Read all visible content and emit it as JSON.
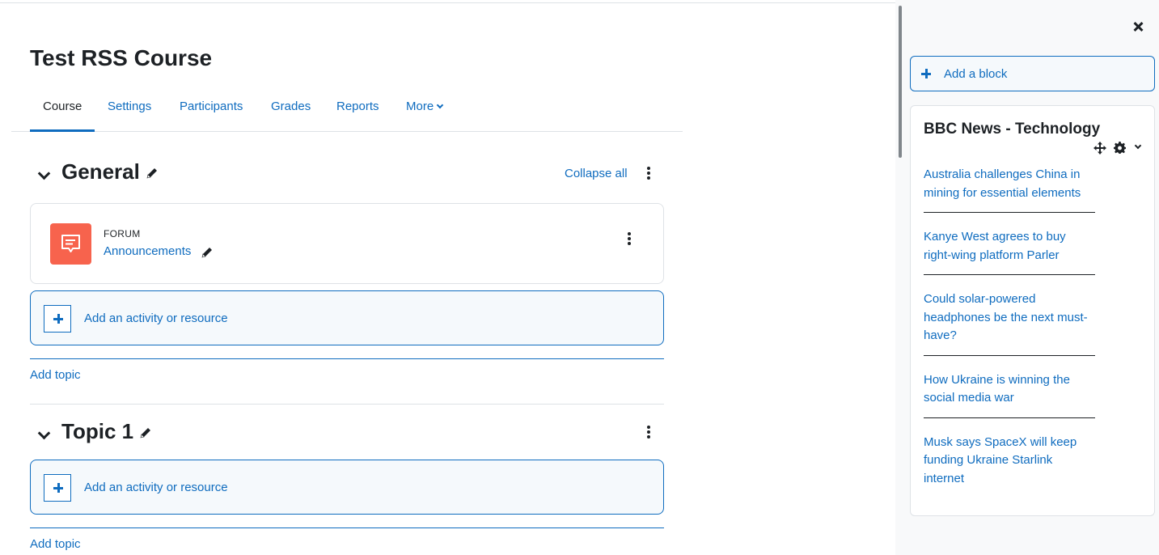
{
  "course": {
    "title": "Test RSS Course"
  },
  "nav": {
    "tabs": [
      {
        "label": "Course",
        "active": true
      },
      {
        "label": "Settings"
      },
      {
        "label": "Participants"
      },
      {
        "label": "Grades"
      },
      {
        "label": "Reports"
      },
      {
        "label": "More"
      }
    ]
  },
  "sections": {
    "general": {
      "title": "General",
      "collapse_all": "Collapse all",
      "activity": {
        "type": "FORUM",
        "name": "Announcements",
        "icon": "forum-icon",
        "icon_color": "#f7634d"
      },
      "add_activity": "Add an activity or resource",
      "add_topic": "Add topic"
    },
    "topic1": {
      "title": "Topic 1",
      "add_activity": "Add an activity or resource",
      "add_topic": "Add topic"
    }
  },
  "drawer": {
    "add_block": "Add a block",
    "block": {
      "title": "BBC News - Technology",
      "items": [
        "Australia challenges China in mining for essential elements",
        "Kanye West agrees to buy right-wing platform Parler",
        "Could solar-powered headphones be the next must-have?",
        "How Ukraine is winning the social media war",
        "Musk says SpaceX will keep funding Ukraine Starlink internet"
      ]
    }
  },
  "colors": {
    "link": "#0f6cbf",
    "text": "#1d2125",
    "drawer_bg": "#f8f9fa",
    "forum": "#f7634d"
  }
}
